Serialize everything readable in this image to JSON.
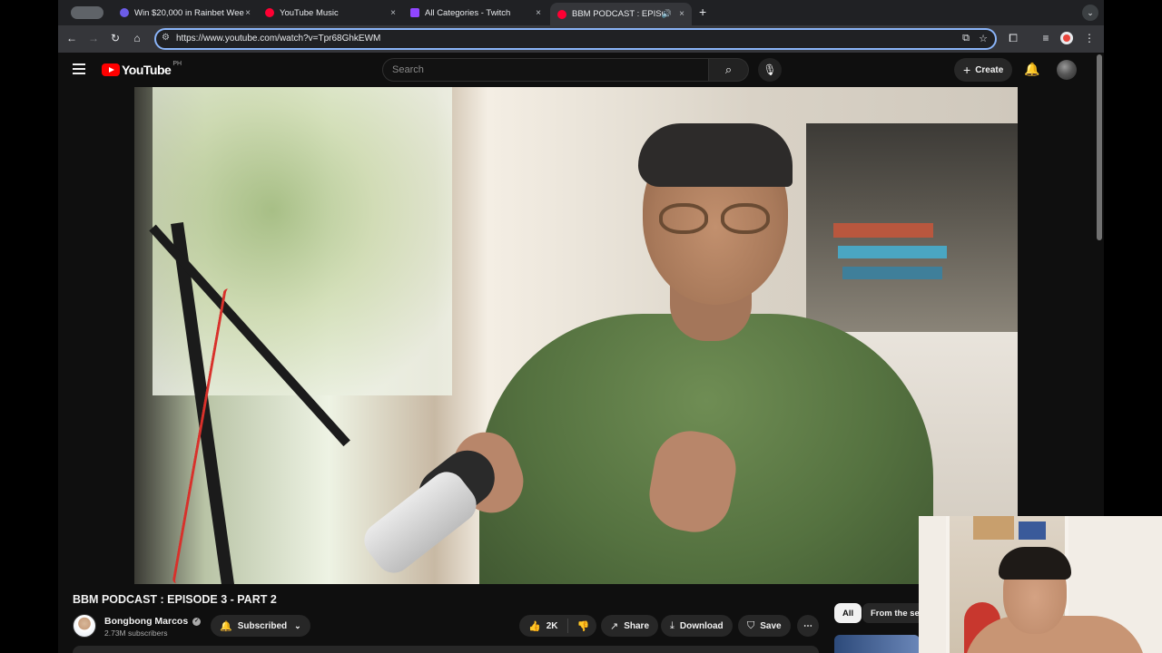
{
  "browser": {
    "tabs": [
      {
        "title": "Win $20,000 in Rainbet Wee",
        "favicon_color": "#6c5ce7"
      },
      {
        "title": "YouTube Music",
        "favicon_color": "#ff0033"
      },
      {
        "title": "All Categories - Twitch",
        "favicon_color": "#9146ff"
      },
      {
        "title": "BBM PODCAST : EPISOD",
        "favicon_color": "#ff0033",
        "active": true
      }
    ],
    "close_glyph": "×",
    "new_tab_glyph": "+",
    "url": "https://www.youtube.com/watch?v=Tpr68GhkEWM"
  },
  "youtube": {
    "logo_text": "YouTube",
    "region": "PH",
    "search_placeholder": "Search",
    "create_label": "Create"
  },
  "video": {
    "title": "BBM PODCAST : EPISODE 3 - PART 2",
    "channel_name": "Bongbong Marcos",
    "subscribers": "2.73M subscribers",
    "subscribed_label": "Subscribed",
    "likes": "2K",
    "share_label": "Share",
    "download_label": "Download",
    "save_label": "Save"
  },
  "chips": [
    {
      "label": "All",
      "selected": true
    },
    {
      "label": "From the ser",
      "selected": false
    }
  ],
  "colors": {
    "accent_red": "#ff0000",
    "background": "#0f0f0f",
    "omnibox_focus": "#8ab4f8"
  }
}
